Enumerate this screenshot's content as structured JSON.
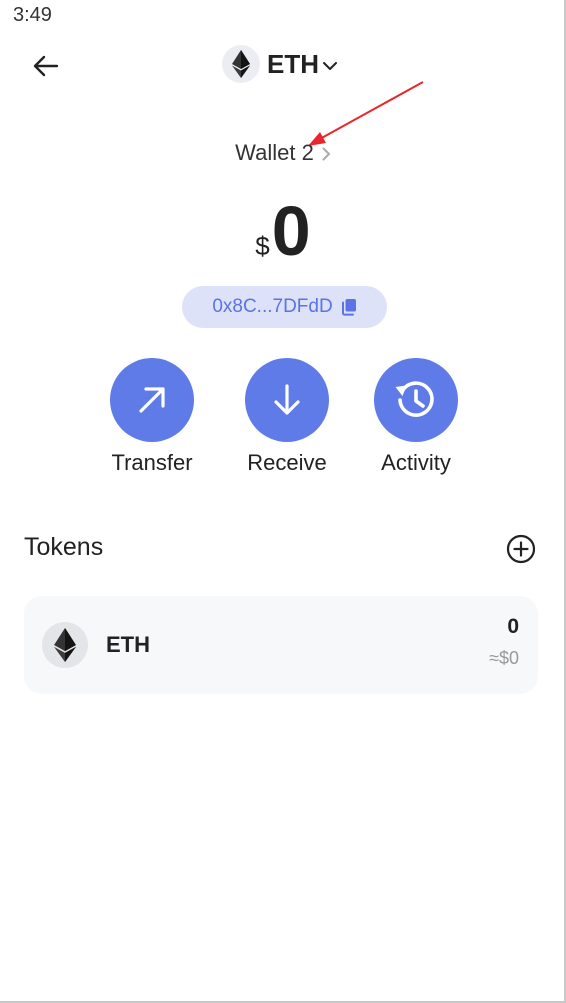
{
  "status_bar": {
    "time": "3:49"
  },
  "header": {
    "back_icon": "arrow-left-icon",
    "network_icon": "ethereum-logo-icon",
    "network": "ETH",
    "dropdown_icon": "chevron-down-icon"
  },
  "wallet": {
    "name": "Wallet 2",
    "chevron_icon": "chevron-right-icon"
  },
  "balance": {
    "symbol": "$",
    "value": "0"
  },
  "address": {
    "short": "0x8C...7DFdD",
    "copy_icon": "copy-icon"
  },
  "actions": [
    {
      "label": "Transfer",
      "icon": "arrow-up-right-icon"
    },
    {
      "label": "Receive",
      "icon": "arrow-down-icon"
    },
    {
      "label": "Activity",
      "icon": "history-icon"
    }
  ],
  "tokens": {
    "title": "Tokens",
    "add_icon": "plus-circle-icon",
    "items": [
      {
        "symbol": "ETH",
        "icon": "ethereum-logo-icon",
        "amount": "0",
        "fiat": "≈$0"
      }
    ]
  },
  "colors": {
    "accent": "#5f7be8",
    "address_pill_bg": "#dde2f8",
    "address_text": "#5b73e5",
    "annotation_arrow": "#e8262b",
    "card_bg": "#f7f8fa"
  }
}
